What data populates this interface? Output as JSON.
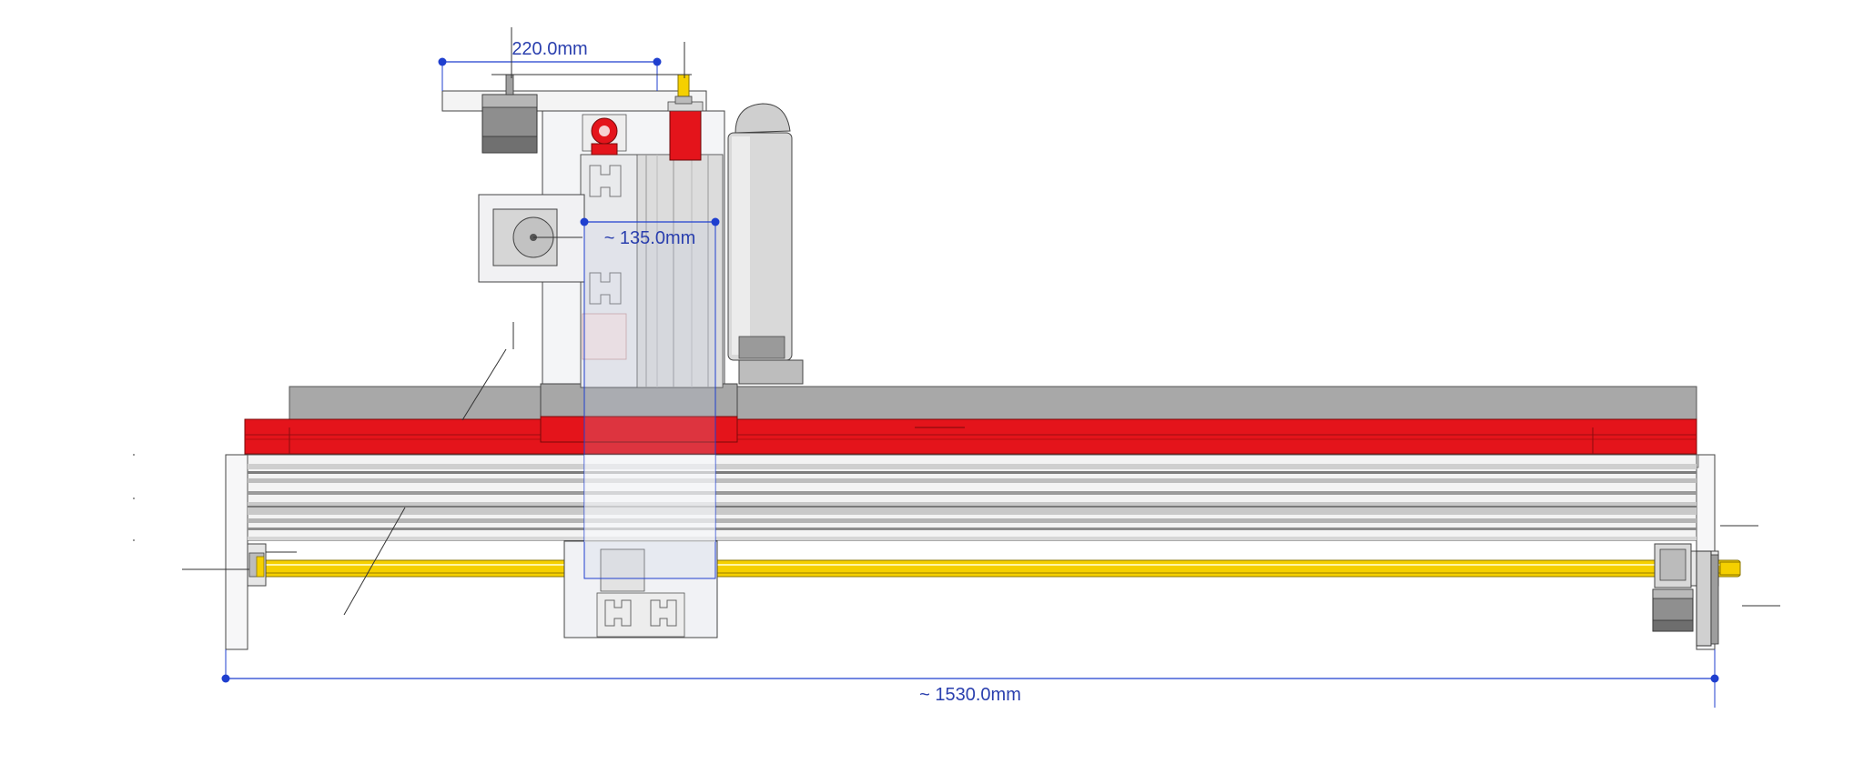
{
  "dimensions": {
    "top_width": "220.0mm",
    "carriage_width": "~ 135.0mm",
    "overall_length": "~ 1530.0mm"
  },
  "colors": {
    "dimension_line": "#1f3fcf",
    "dimension_text": "#2a3fae",
    "rail_red": "#e4141b",
    "rod_yellow": "#f5d000",
    "plate_gray": "#a9a9a9",
    "frame_light": "#f4f5f7",
    "outline": "#3c3c3c"
  }
}
